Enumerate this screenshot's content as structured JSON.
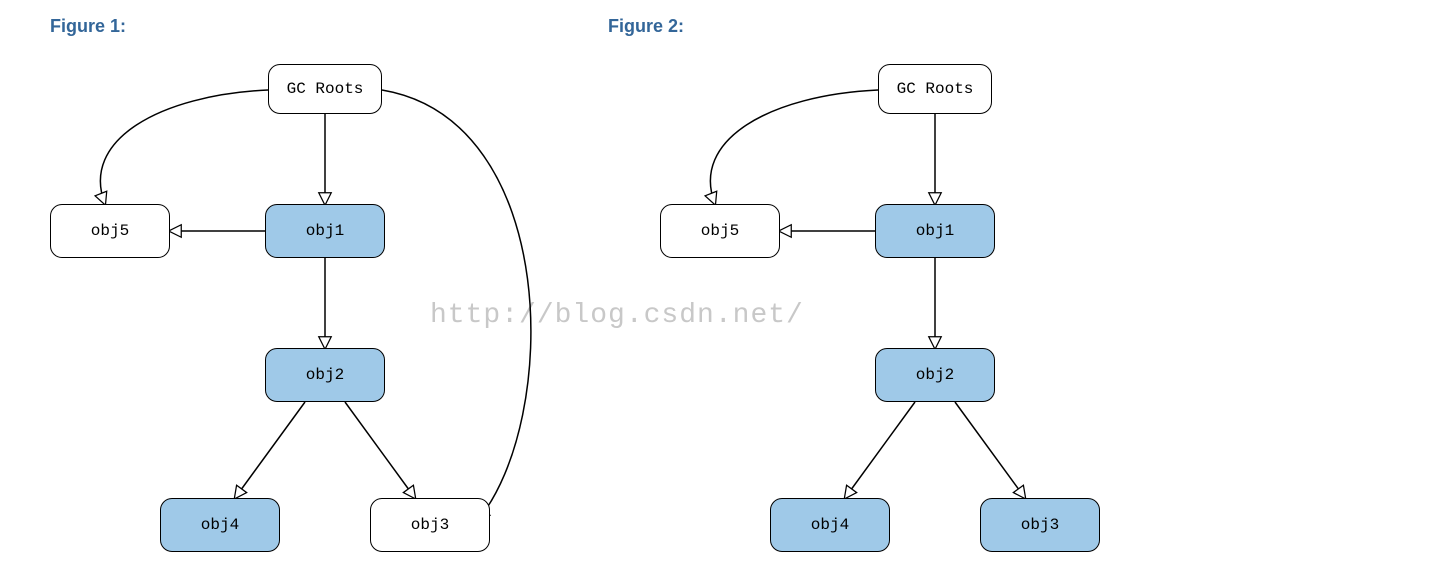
{
  "chart_data": {
    "type": "diagram",
    "title": "GC Roots dominator / reachability diagram",
    "figures": [
      {
        "name": "Figure 1:",
        "nodes": [
          {
            "id": "gcroots",
            "label": "GC Roots",
            "fill": "white"
          },
          {
            "id": "obj1",
            "label": "obj1",
            "fill": "blue"
          },
          {
            "id": "obj2",
            "label": "obj2",
            "fill": "blue"
          },
          {
            "id": "obj3",
            "label": "obj3",
            "fill": "white"
          },
          {
            "id": "obj4",
            "label": "obj4",
            "fill": "blue"
          },
          {
            "id": "obj5",
            "label": "obj5",
            "fill": "white"
          }
        ],
        "edges": [
          {
            "from": "gcroots",
            "to": "obj1"
          },
          {
            "from": "gcroots",
            "to": "obj5"
          },
          {
            "from": "gcroots",
            "to": "obj3"
          },
          {
            "from": "obj1",
            "to": "obj5"
          },
          {
            "from": "obj1",
            "to": "obj2"
          },
          {
            "from": "obj2",
            "to": "obj4"
          },
          {
            "from": "obj2",
            "to": "obj3"
          }
        ]
      },
      {
        "name": "Figure 2:",
        "nodes": [
          {
            "id": "gcroots",
            "label": "GC Roots",
            "fill": "white"
          },
          {
            "id": "obj1",
            "label": "obj1",
            "fill": "blue"
          },
          {
            "id": "obj2",
            "label": "obj2",
            "fill": "blue"
          },
          {
            "id": "obj3",
            "label": "obj3",
            "fill": "blue"
          },
          {
            "id": "obj4",
            "label": "obj4",
            "fill": "blue"
          },
          {
            "id": "obj5",
            "label": "obj5",
            "fill": "white"
          }
        ],
        "edges": [
          {
            "from": "gcroots",
            "to": "obj1"
          },
          {
            "from": "gcroots",
            "to": "obj5"
          },
          {
            "from": "obj1",
            "to": "obj5"
          },
          {
            "from": "obj1",
            "to": "obj2"
          },
          {
            "from": "obj2",
            "to": "obj4"
          },
          {
            "from": "obj2",
            "to": "obj3"
          }
        ]
      }
    ],
    "watermark": "http://blog.csdn.net/"
  },
  "titles": {
    "fig1": "Figure 1:",
    "fig2": "Figure 2:"
  },
  "labels": {
    "gcroots": "GC Roots",
    "obj1": "obj1",
    "obj2": "obj2",
    "obj3": "obj3",
    "obj4": "obj4",
    "obj5": "obj5"
  },
  "watermark": "http://blog.csdn.net/"
}
